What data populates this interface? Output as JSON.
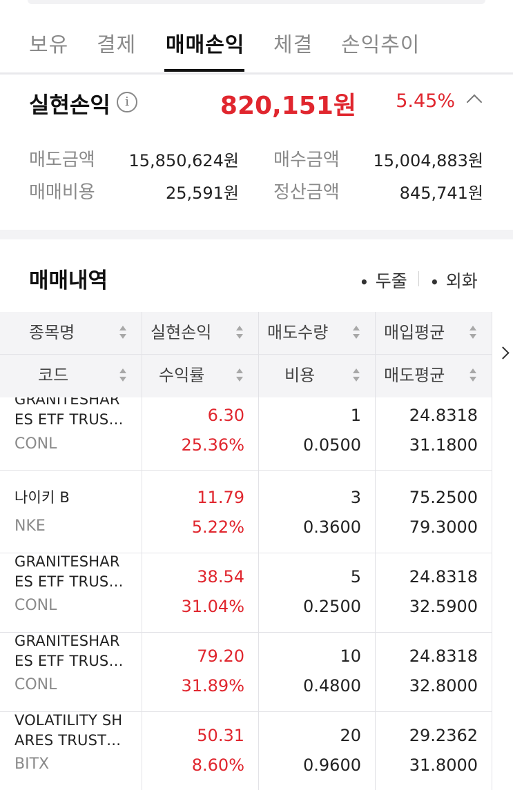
{
  "tabs": [
    {
      "label": "보유",
      "active": false
    },
    {
      "label": "결제",
      "active": false
    },
    {
      "label": "매매손익",
      "active": true
    },
    {
      "label": "체결",
      "active": false
    },
    {
      "label": "손익추이",
      "active": false
    }
  ],
  "summary": {
    "title": "실현손익",
    "info_icon": "info-icon",
    "amount": "820,151원",
    "rate": "5.45%",
    "collapse_icon": "chevron-up-icon",
    "stats": [
      {
        "label": "매도금액",
        "value": "15,850,624원"
      },
      {
        "label": "매수금액",
        "value": "15,004,883원"
      },
      {
        "label": "매매비용",
        "value": "25,591원"
      },
      {
        "label": "정산금액",
        "value": "845,741원"
      }
    ]
  },
  "history": {
    "title": "매매내역",
    "options": [
      {
        "label": "두줄"
      },
      {
        "label": "외화"
      }
    ],
    "columns_row1": [
      "종목명",
      "실현손익",
      "매도수량",
      "매입평균"
    ],
    "columns_row2": [
      "코드",
      "수익률",
      "비용",
      "매도평균"
    ],
    "rows": [
      {
        "name": "GRANITESHAR\nES ETF TRUS…",
        "code": "CONL",
        "profit": "6.30",
        "rate": "25.36%",
        "qty": "1",
        "fee": "0.0500",
        "buy_avg": "24.8318",
        "sell_avg": "31.1800"
      },
      {
        "name": "나이키 B",
        "code": "NKE",
        "profit": "11.79",
        "rate": "5.22%",
        "qty": "3",
        "fee": "0.3600",
        "buy_avg": "75.2500",
        "sell_avg": "79.3000"
      },
      {
        "name": "GRANITESHAR\nES ETF TRUS…",
        "code": "CONL",
        "profit": "38.54",
        "rate": "31.04%",
        "qty": "5",
        "fee": "0.2500",
        "buy_avg": "24.8318",
        "sell_avg": "32.5900"
      },
      {
        "name": "GRANITESHAR\nES ETF TRUS…",
        "code": "CONL",
        "profit": "79.20",
        "rate": "31.89%",
        "qty": "10",
        "fee": "0.4800",
        "buy_avg": "24.8318",
        "sell_avg": "32.8000"
      },
      {
        "name": "VOLATILITY SH\nARES TRUST…",
        "code": "BITX",
        "profit": "50.31",
        "rate": "8.60%",
        "qty": "20",
        "fee": "0.9600",
        "buy_avg": "29.2362",
        "sell_avg": "31.8000"
      }
    ]
  },
  "colors": {
    "accent_red": "#e0262e",
    "text_dark": "#111111",
    "text_muted": "#8a8a8a",
    "header_bg": "#f4f4f6"
  }
}
